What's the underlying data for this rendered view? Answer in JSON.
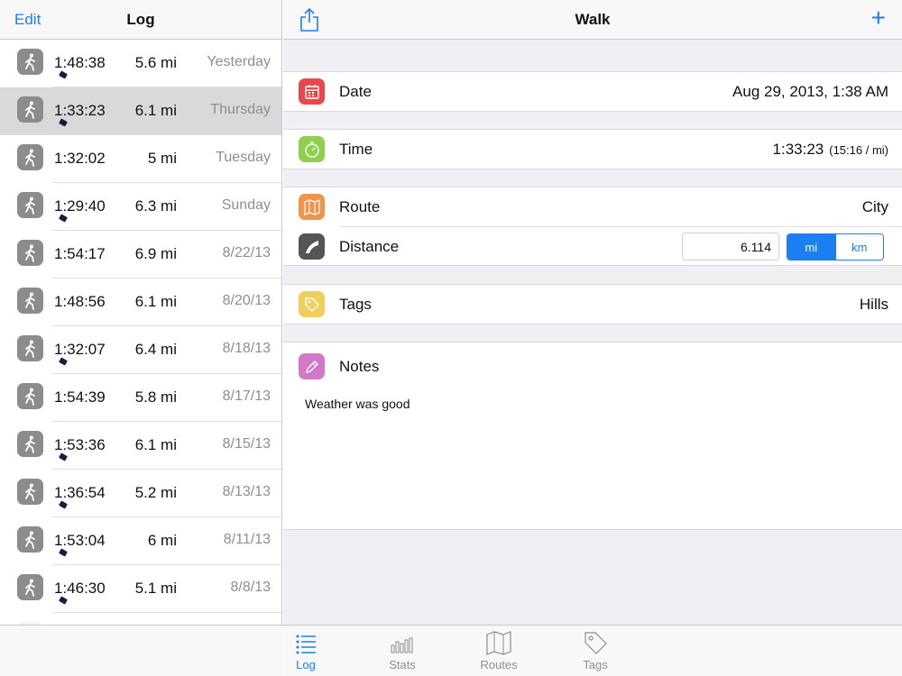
{
  "log": {
    "edit_label": "Edit",
    "title": "Log",
    "entries": [
      {
        "time": "1:48:38",
        "distance": "5.6 mi",
        "date": "Yesterday",
        "tagged": true,
        "selected": false
      },
      {
        "time": "1:33:23",
        "distance": "6.1 mi",
        "date": "Thursday",
        "tagged": true,
        "selected": true
      },
      {
        "time": "1:32:02",
        "distance": "5 mi",
        "date": "Tuesday",
        "tagged": false,
        "selected": false
      },
      {
        "time": "1:29:40",
        "distance": "6.3 mi",
        "date": "Sunday",
        "tagged": true,
        "selected": false
      },
      {
        "time": "1:54:17",
        "distance": "6.9 mi",
        "date": "8/22/13",
        "tagged": false,
        "selected": false
      },
      {
        "time": "1:48:56",
        "distance": "6.1 mi",
        "date": "8/20/13",
        "tagged": false,
        "selected": false
      },
      {
        "time": "1:32:07",
        "distance": "6.4 mi",
        "date": "8/18/13",
        "tagged": true,
        "selected": false
      },
      {
        "time": "1:54:39",
        "distance": "5.8 mi",
        "date": "8/17/13",
        "tagged": false,
        "selected": false
      },
      {
        "time": "1:53:36",
        "distance": "6.1 mi",
        "date": "8/15/13",
        "tagged": true,
        "selected": false
      },
      {
        "time": "1:36:54",
        "distance": "5.2 mi",
        "date": "8/13/13",
        "tagged": true,
        "selected": false
      },
      {
        "time": "1:53:04",
        "distance": "6 mi",
        "date": "8/11/13",
        "tagged": true,
        "selected": false
      },
      {
        "time": "1:46:30",
        "distance": "5.1 mi",
        "date": "8/8/13",
        "tagged": true,
        "selected": false
      }
    ]
  },
  "detail": {
    "title": "Walk",
    "add_label": "+",
    "date": {
      "label": "Date",
      "value": "Aug 29, 2013, 1:38 AM",
      "icon": "calendar-icon",
      "color": "#e8474b"
    },
    "time": {
      "label": "Time",
      "value": "1:33:23",
      "pace": "(15:16 / mi)",
      "icon": "stopwatch-icon",
      "color": "#8fd14f"
    },
    "route": {
      "label": "Route",
      "value": "City",
      "icon": "map-icon",
      "color": "#f0944c"
    },
    "distance": {
      "label": "Distance",
      "value": "6.114",
      "icon": "road-icon",
      "color": "#555555",
      "units": {
        "mi": "mi",
        "km": "km",
        "selected": "mi"
      }
    },
    "tags": {
      "label": "Tags",
      "value": "Hills",
      "icon": "tag-icon",
      "color": "#f0cf5a"
    },
    "notes": {
      "label": "Notes",
      "text": "Weather was good",
      "icon": "pencil-icon",
      "color": "#d178c8"
    }
  },
  "tabbar": {
    "tabs": [
      {
        "label": "Log",
        "icon": "list-icon",
        "active": true
      },
      {
        "label": "Stats",
        "icon": "bar-chart-icon",
        "active": false
      },
      {
        "label": "Routes",
        "icon": "map-icon",
        "active": false
      },
      {
        "label": "Tags",
        "icon": "tag-icon",
        "active": false
      }
    ]
  },
  "colors": {
    "accent": "#1a7ff0",
    "selected_row": "#d9d9d9",
    "icon_gray": "#8c8c8c"
  }
}
